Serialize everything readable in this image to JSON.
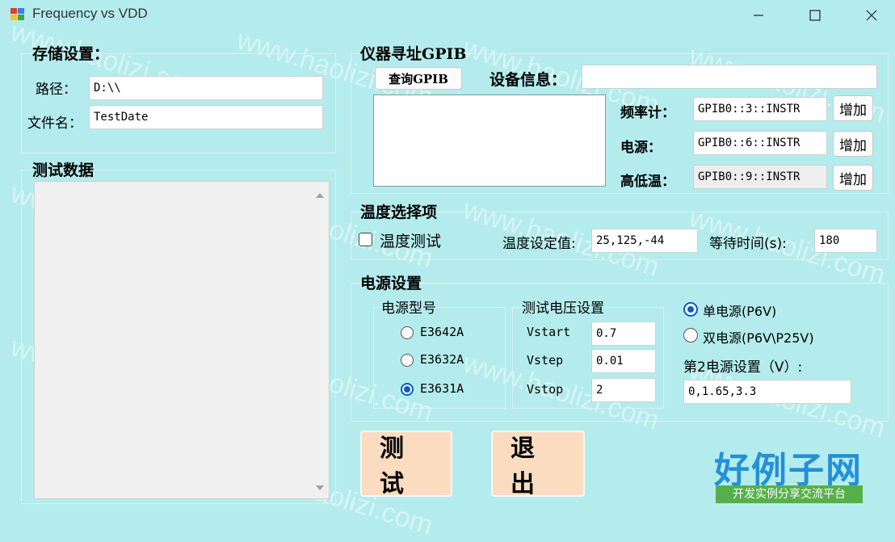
{
  "window": {
    "title": "Frequency vs VDD",
    "minimize_icon": "minimize-icon",
    "maximize_icon": "maximize-icon",
    "close_icon": "close-icon"
  },
  "storage": {
    "heading": "存储设置：",
    "path_label": "路径：",
    "path_value": "D:\\\\",
    "filename_label": "文件名：",
    "filename_value": "TestDate"
  },
  "test_data": {
    "heading": "测试数据"
  },
  "gpib": {
    "heading": "仪器寻址GPIB",
    "query_button": "查询GPIB",
    "device_info_label": "设备信息：",
    "device_info_value": "",
    "instruments": [
      {
        "label": "频率计：",
        "address": "GPIB0::3::INSTR",
        "add_label": "增加"
      },
      {
        "label": "电源：",
        "address": "GPIB0::6::INSTR",
        "add_label": "增加"
      },
      {
        "label": "高低温：",
        "address": "GPIB0::9::INSTR",
        "add_label": "增加"
      }
    ]
  },
  "temperature": {
    "heading": "温度选择项",
    "checkbox_label": "温度测试",
    "checked": false,
    "setpoint_label": "温度设定值:",
    "setpoint_value": "25,125,-44",
    "wait_label": "等待时间(s):",
    "wait_value": "180"
  },
  "power": {
    "heading": "电源设置",
    "model_heading": "电源型号",
    "models": [
      {
        "label": "E3642A",
        "selected": false
      },
      {
        "label": "E3632A",
        "selected": false
      },
      {
        "label": "E3631A",
        "selected": true
      }
    ],
    "voltage_heading": "测试电压设置",
    "vstart_label": "Vstart",
    "vstart_value": "0.7",
    "vstep_label": "Vstep",
    "vstep_value": "0.01",
    "vstop_label": "Vstop",
    "vstop_value": "2",
    "single_label": "单电源(P6V)",
    "dual_label": "双电源(P6V\\P25V)",
    "single_selected": true,
    "second_label": "第2电源设置（V）:",
    "second_value": "0,1.65,3.3"
  },
  "actions": {
    "test_label": "测试",
    "exit_label": "退出"
  },
  "branding": {
    "logo_text": "好例子网",
    "logo_subtitle": "开发实例分享交流平台",
    "watermark": "www.haolizi.com"
  },
  "colors": {
    "background": "#b4eced",
    "action_button": "#fcdcc0",
    "radio_selected": "#0c5cc4",
    "logo": "#2390d8",
    "logo_subtitle_bg": "#56b04a"
  }
}
